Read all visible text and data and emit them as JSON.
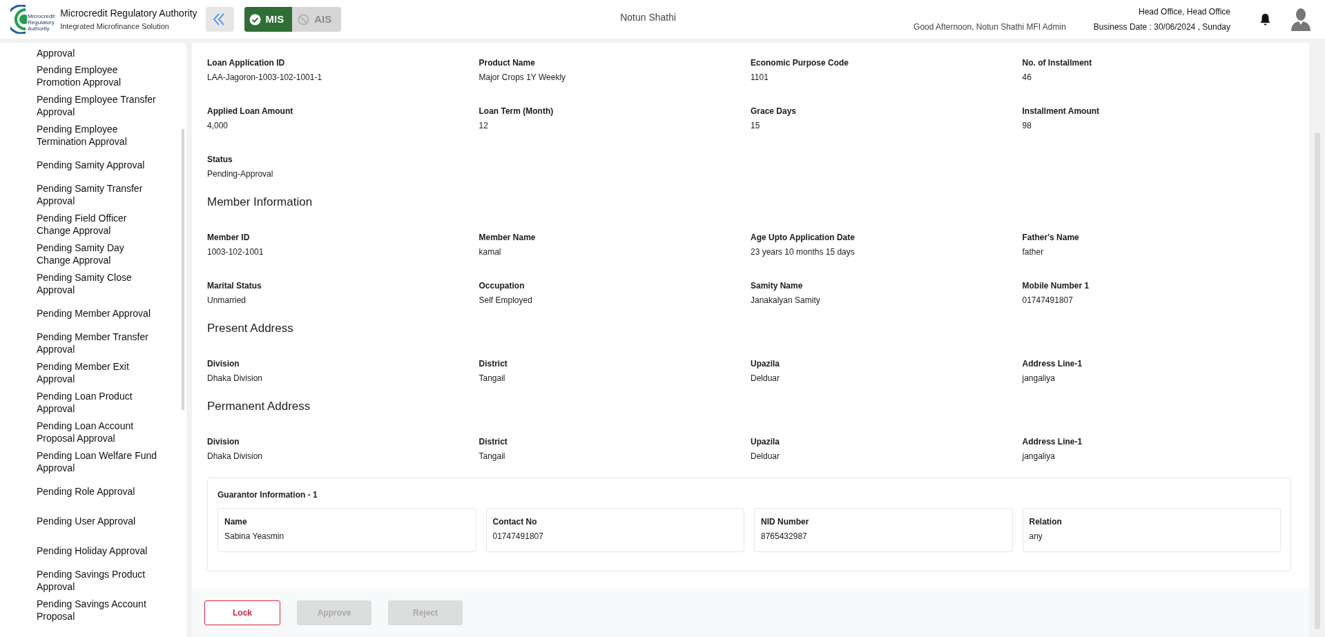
{
  "header": {
    "org_title": "Microcredit Regulatory Authority",
    "org_subtitle": "Integrated Microfinance Solution",
    "logo_text": "Microcredit\nRegulatory\nAuthority",
    "modules": [
      {
        "label": "MIS",
        "selected": true
      },
      {
        "label": "AIS",
        "selected": false
      }
    ],
    "center_title": "Notun Shathi",
    "greeting": "Good Afternoon, Notun Shathi MFI Admin",
    "office": "Head Office, Head Office",
    "business_date": "Business Date : 30/06/2024 , Sunday"
  },
  "sidebar": {
    "items": [
      {
        "label": "Approval"
      },
      {
        "label": "Pending Employee\nPromotion Approval"
      },
      {
        "label": "Pending Employee Transfer\nApproval"
      },
      {
        "label": "Pending Employee\nTermination Approval"
      },
      {
        "label": "Pending Samity Approval"
      },
      {
        "label": "Pending Samity Transfer\nApproval"
      },
      {
        "label": "Pending Field Officer\nChange Approval"
      },
      {
        "label": "Pending Samity Day\nChange Approval"
      },
      {
        "label": "Pending Samity Close\nApproval"
      },
      {
        "label": "Pending Member Approval"
      },
      {
        "label": "Pending Member Transfer\nApproval"
      },
      {
        "label": "Pending Member Exit\nApproval"
      },
      {
        "label": "Pending Loan Product\nApproval"
      },
      {
        "label": "Pending Loan Account\nProposal Approval"
      },
      {
        "label": "Pending Loan Welfare Fund\nApproval"
      },
      {
        "label": "Pending Role Approval"
      },
      {
        "label": "Pending User Approval"
      },
      {
        "label": "Pending Holiday Approval"
      },
      {
        "label": "Pending Savings Product\nApproval"
      },
      {
        "label": "Pending Savings Account\nProposal"
      }
    ]
  },
  "loan_fields": [
    {
      "label": "Loan Application ID",
      "value": "LAA-Jagoron-1003-102-1001-1"
    },
    {
      "label": "Product Name",
      "value": "Major Crops 1Y Weekly"
    },
    {
      "label": "Economic Purpose Code",
      "value": "1101"
    },
    {
      "label": "No. of Installment",
      "value": "46"
    },
    {
      "label": "Applied Loan Amount",
      "value": "4,000"
    },
    {
      "label": "Loan Term (Month)",
      "value": "12"
    },
    {
      "label": "Grace Days",
      "value": "15"
    },
    {
      "label": "Installment Amount",
      "value": "98"
    },
    {
      "label": "Status",
      "value": "Pending-Approval"
    }
  ],
  "sections": [
    {
      "title": "Member Information",
      "fields": [
        {
          "label": "Member ID",
          "value": "1003-102-1001"
        },
        {
          "label": "Member Name",
          "value": "kamal"
        },
        {
          "label": "Age Upto Application Date",
          "value": "23 years 10 months 15 days"
        },
        {
          "label": "Father's Name",
          "value": "father"
        },
        {
          "label": "Marital Status",
          "value": "Unmarried"
        },
        {
          "label": "Occupation",
          "value": "Self Employed"
        },
        {
          "label": "Samity Name",
          "value": "Janakalyan Samity"
        },
        {
          "label": "Mobile Number 1",
          "value": "01747491807"
        }
      ]
    },
    {
      "title": "Present Address",
      "fields": [
        {
          "label": "Division",
          "value": "Dhaka Division"
        },
        {
          "label": "District",
          "value": "Tangail"
        },
        {
          "label": "Upazila",
          "value": "Delduar"
        },
        {
          "label": "Address Line-1",
          "value": "jangaliya"
        }
      ]
    },
    {
      "title": "Permanent Address",
      "fields": [
        {
          "label": "Division",
          "value": "Dhaka Division"
        },
        {
          "label": "District",
          "value": "Tangail"
        },
        {
          "label": "Upazila",
          "value": "Delduar"
        },
        {
          "label": "Address Line-1",
          "value": "jangaliya"
        }
      ]
    }
  ],
  "guarantor": {
    "title": "Guarantor Information - 1",
    "fields": [
      {
        "label": "Name",
        "value": "Sabina Yeasmin"
      },
      {
        "label": "Contact No",
        "value": "01747491807"
      },
      {
        "label": "NID Number",
        "value": "8765432987"
      },
      {
        "label": "Relation",
        "value": "any"
      }
    ]
  },
  "actions": [
    {
      "label": "Lock",
      "disabled": false
    },
    {
      "label": "Approve",
      "disabled": true
    },
    {
      "label": "Reject",
      "disabled": true
    }
  ]
}
